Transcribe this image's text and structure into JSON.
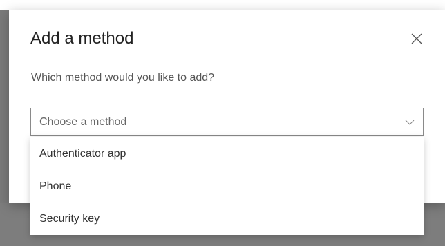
{
  "modal": {
    "title": "Add a method",
    "question": "Which method would you like to add?",
    "close_icon": "close-icon"
  },
  "select": {
    "value": "Choose a method",
    "icon": "chevron-down-icon",
    "options": [
      "Authenticator app",
      "Phone",
      "Security key"
    ]
  },
  "colors": {
    "overlay": "#7a7a7a",
    "modal_bg": "#ffffff",
    "border": "#8a8a8a",
    "text_primary": "#222222",
    "text_secondary": "#555555"
  }
}
